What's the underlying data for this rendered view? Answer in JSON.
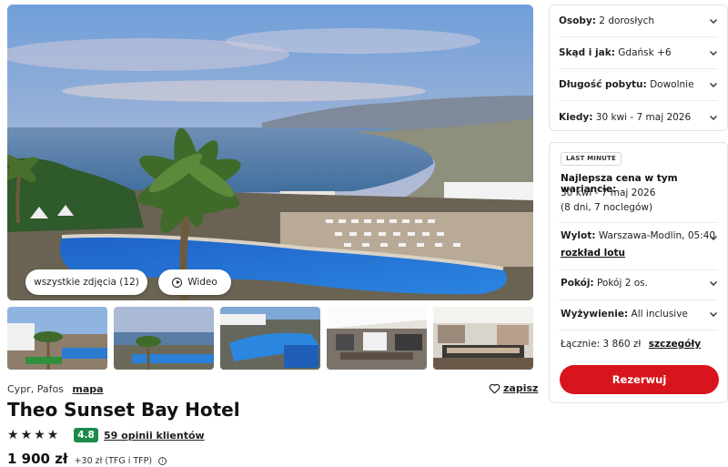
{
  "gallery": {
    "all_photos_label": "wszystkie zdjęcia (12)",
    "video_label": "Wideo",
    "thumbnails": [
      "thumb-1",
      "thumb-2",
      "thumb-3",
      "thumb-4",
      "thumb-5"
    ]
  },
  "hotel": {
    "location": "Cypr, Pafos",
    "map_label": "mapa",
    "save_label": "zapisz",
    "name": "Theo Sunset Bay Hotel",
    "stars": 4,
    "rating": "4.8",
    "reviews_label": "59 opinii klientów",
    "price": "1 900 zł",
    "price_extra": "+30 zł (TFG i TFP)"
  },
  "filters": [
    {
      "label": "Osoby:",
      "value": "2 dorosłych"
    },
    {
      "label": "Skąd i jak:",
      "value": "Gdańsk +6"
    },
    {
      "label": "Długość pobytu:",
      "value": "Dowolnie"
    },
    {
      "label": "Kiedy:",
      "value": "30 kwi - 7 maj 2026"
    }
  ],
  "offer": {
    "badge": "LAST MINUTE",
    "best_title": "Najlepsza cena w tym wariancie:",
    "dates": "30 kwi - 7 maj 2026",
    "nights": "(8 dni, 7 noclegów)",
    "flight_label": "Wylot:",
    "flight_value": "Warszawa-Modlin, 05:40",
    "schedule_label": "rozkład lotu",
    "room_label": "Pokój:",
    "room_value": "Pokój 2 os.",
    "board_label": "Wyżywienie:",
    "board_value": "All inclusive",
    "total_label": "Łącznie: 3 860 zł",
    "details_label": "szczegóły",
    "book_label": "Rezerwuj"
  },
  "colors": {
    "accent": "#d8141c",
    "rating_green": "#1b8a4b"
  }
}
